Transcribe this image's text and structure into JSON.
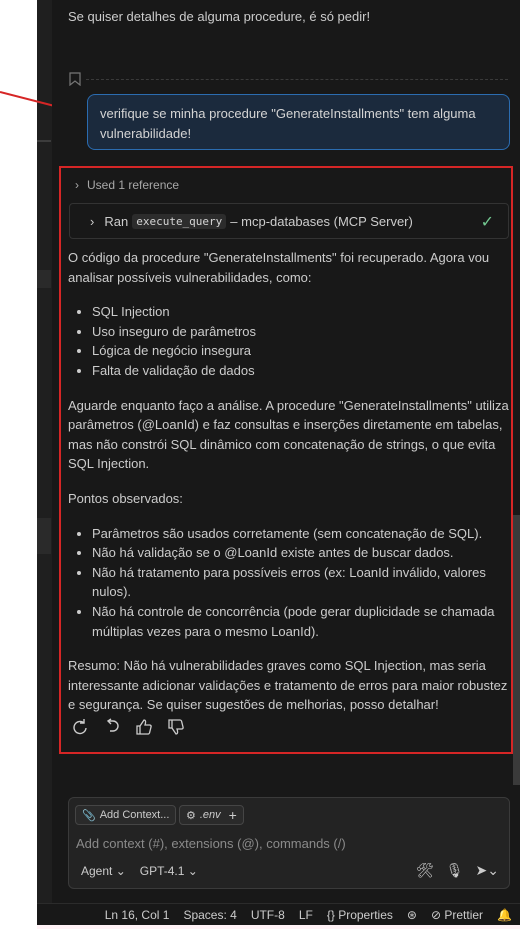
{
  "chat": {
    "previous_message": "Se quiser detalhes de alguma procedure, é só pedir!",
    "user_message": "verifique se minha procedure \"GenerateInstallments\" tem alguma vulnerabilidade!",
    "references_label": "Used 1 reference",
    "tool_call": {
      "prefix": "Ran",
      "command": "execute_query",
      "suffix": "– mcp-databases (MCP Server)"
    },
    "response": {
      "intro": "O código da procedure \"GenerateInstallments\" foi recuperado. Agora vou analisar possíveis vulnerabilidades, como:",
      "checks": [
        "SQL Injection",
        "Uso inseguro de parâmetros",
        "Lógica de negócio insegura",
        "Falta de validação de dados"
      ],
      "analysis": "Aguarde enquanto faço a análise. A procedure \"GenerateInstallments\" utiliza parâmetros (@LoanId) e faz consultas e inserções diretamente em tabelas, mas não constrói SQL dinâmico com concatenação de strings, o que evita SQL Injection.",
      "observed_heading": "Pontos observados:",
      "observations": [
        "Parâmetros são usados corretamente (sem concatenação de SQL).",
        "Não há validação se o @LoanId existe antes de buscar dados.",
        "Não há tratamento para possíveis erros (ex: LoanId inválido, valores nulos).",
        "Não há controle de concorrência (pode gerar duplicidade se chamada múltiplas vezes para o mesmo LoanId)."
      ],
      "summary": "Resumo: Não há vulnerabilidades graves como SQL Injection, mas seria interessante adicionar validações e tratamento de erros para maior robustez e segurança. Se quiser sugestões de melhorias, posso detalhar!"
    }
  },
  "input": {
    "add_context_label": "Add Context...",
    "env_chip_label": ".env",
    "placeholder": "Add context (#), extensions (@), commands (/)",
    "mode_label": "Agent",
    "model_label": "GPT-4.1"
  },
  "statusbar": {
    "position": "Ln 16, Col 1",
    "spaces": "Spaces: 4",
    "encoding": "UTF-8",
    "eol": "LF",
    "language": "Properties",
    "formatter": "Prettier"
  },
  "colors": {
    "panel_bg": "#181818",
    "highlight_border": "#d62626",
    "user_bubble_border": "#2b6cb0",
    "check": "#73c991"
  }
}
